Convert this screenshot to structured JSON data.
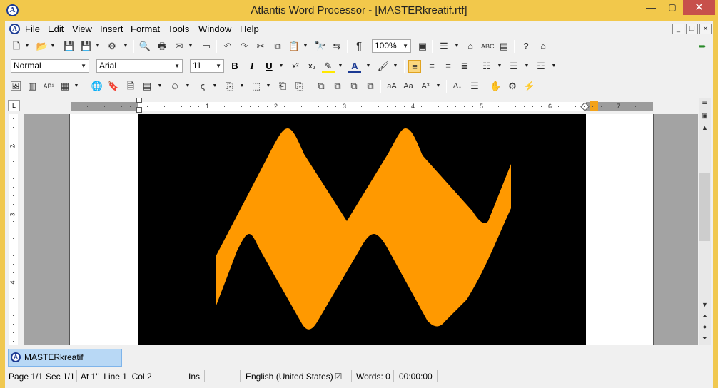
{
  "window": {
    "title": "Atlantis Word Processor - [MASTERkreatif.rtf]",
    "minimize": "—",
    "maximize": "▢",
    "close": "✕"
  },
  "app_logo": "A",
  "menu": [
    "File",
    "Edit",
    "View",
    "Insert",
    "Format",
    "Tools",
    "Window",
    "Help"
  ],
  "mdi_controls": [
    "_",
    "❐",
    "✕"
  ],
  "toolbar1": {
    "zoom": "100%"
  },
  "format_bar": {
    "style": "Normal",
    "font": "Arial",
    "size": "11",
    "bold": "B",
    "italic": "I",
    "underline": "U",
    "superscript": "x²",
    "subscript": "x₂"
  },
  "ruler": {
    "corner": "L",
    "h_numbers": [
      "1",
      "2",
      "3",
      "4",
      "5",
      "6",
      "7"
    ],
    "v_numbers": [
      "2",
      "3",
      "4"
    ]
  },
  "colors": {
    "accent": "#ff9900",
    "image_bg": "#000000",
    "titlebar": "#f2c84b"
  },
  "doc_tab": {
    "label": "MASTERkreatif"
  },
  "status": {
    "page": "Page 1/1",
    "sec": "Sec 1/1",
    "position": "At 1\"  Line 1  Col 2",
    "mode": "Ins",
    "language": "English (United States)",
    "words": "Words: 0",
    "time": "00:00:00"
  }
}
